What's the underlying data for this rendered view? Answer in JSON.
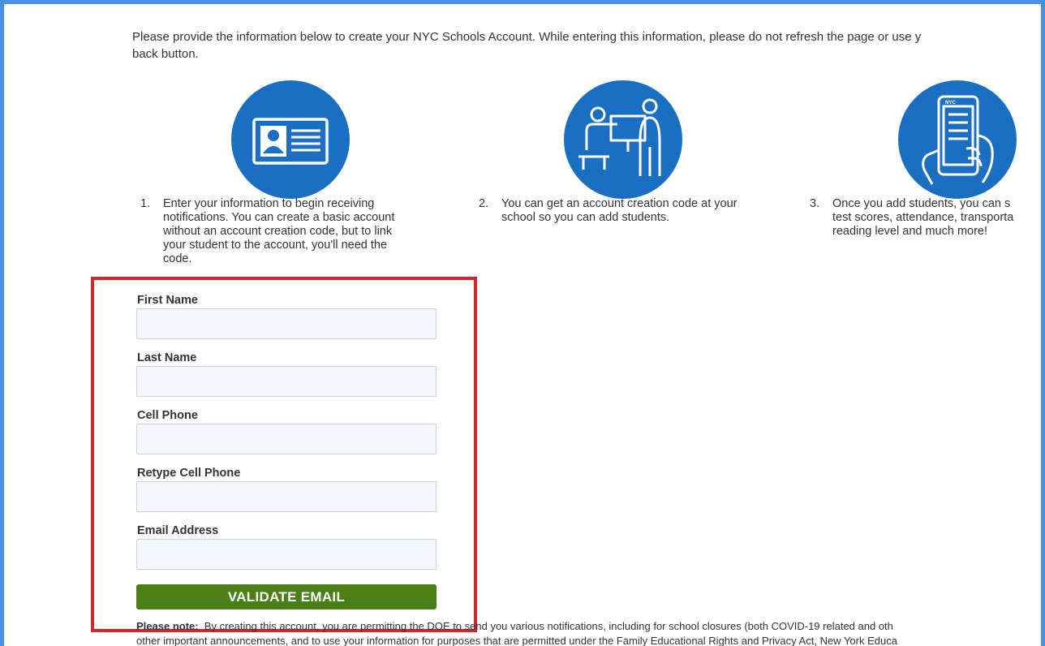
{
  "intro": {
    "line1": "Please provide the information below to create your NYC Schools Account. While entering this information, please do not refresh the page or use y",
    "line2": "back button."
  },
  "steps": [
    {
      "number": "1.",
      "icon": "id-card-icon",
      "lines": [
        "Enter your information to begin receiving",
        "notifications. You can create a basic account",
        "without an account creation code, but to link",
        "your student to the account, you'll need the",
        "code."
      ]
    },
    {
      "number": "2.",
      "icon": "presenter-icon",
      "lines": [
        "You can get an account creation code at your",
        "school so you can add students."
      ]
    },
    {
      "number": "3.",
      "icon": "phone-hand-icon",
      "lines": [
        "Once you add students, you can s",
        "test scores, attendance, transporta",
        "reading level and much more!"
      ]
    }
  ],
  "form": {
    "first_name": {
      "label": "First Name",
      "value": ""
    },
    "last_name": {
      "label": "Last Name",
      "value": ""
    },
    "cell_phone": {
      "label": "Cell Phone",
      "value": ""
    },
    "retype_cell_phone": {
      "label": "Retype Cell Phone",
      "value": ""
    },
    "email": {
      "label": "Email Address",
      "value": ""
    },
    "validate_button": "VALIDATE EMAIL"
  },
  "note": {
    "label": "Please note:",
    "line1": "By creating this account, you are permitting the DOE to send you various notifications, including for school closures (both COVID-19 related and oth",
    "line2": "other important announcements, and to use your information for purposes that are permitted under the Family Educational Rights and Privacy Act, New York Educa"
  },
  "colors": {
    "frame_border": "#4a90e2",
    "icon_circle": "#1b6fc2",
    "highlight_border": "#d0262d",
    "button_green": "#4a7f17",
    "input_background": "#f4f7fc"
  }
}
